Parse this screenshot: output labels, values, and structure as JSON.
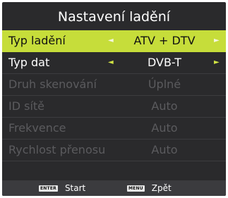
{
  "menu": {
    "title": "Nastavení ladění",
    "rows": [
      {
        "label": "Typ ladění",
        "value": "ATV + DTV",
        "left_arrow": "◄",
        "right_arrow": "►"
      },
      {
        "label": "Typ dat",
        "value": "DVB-T",
        "left_arrow": "◄",
        "right_arrow": "►"
      },
      {
        "label": "Druh skenování",
        "value": "Úplné"
      },
      {
        "label": "ID sítě",
        "value": "Auto"
      },
      {
        "label": "Frekvence",
        "value": "Auto"
      },
      {
        "label": "Rychlost přenosu",
        "value": "Auto"
      }
    ]
  },
  "footer": {
    "enter_key": "ENTER",
    "enter_label": "Start",
    "menu_key": "MENU",
    "menu_label": "Zpět"
  },
  "colors": {
    "highlight": "#c6dd3a",
    "panel": "#2a2a2c",
    "disabled_text": "#5b5b5e"
  }
}
